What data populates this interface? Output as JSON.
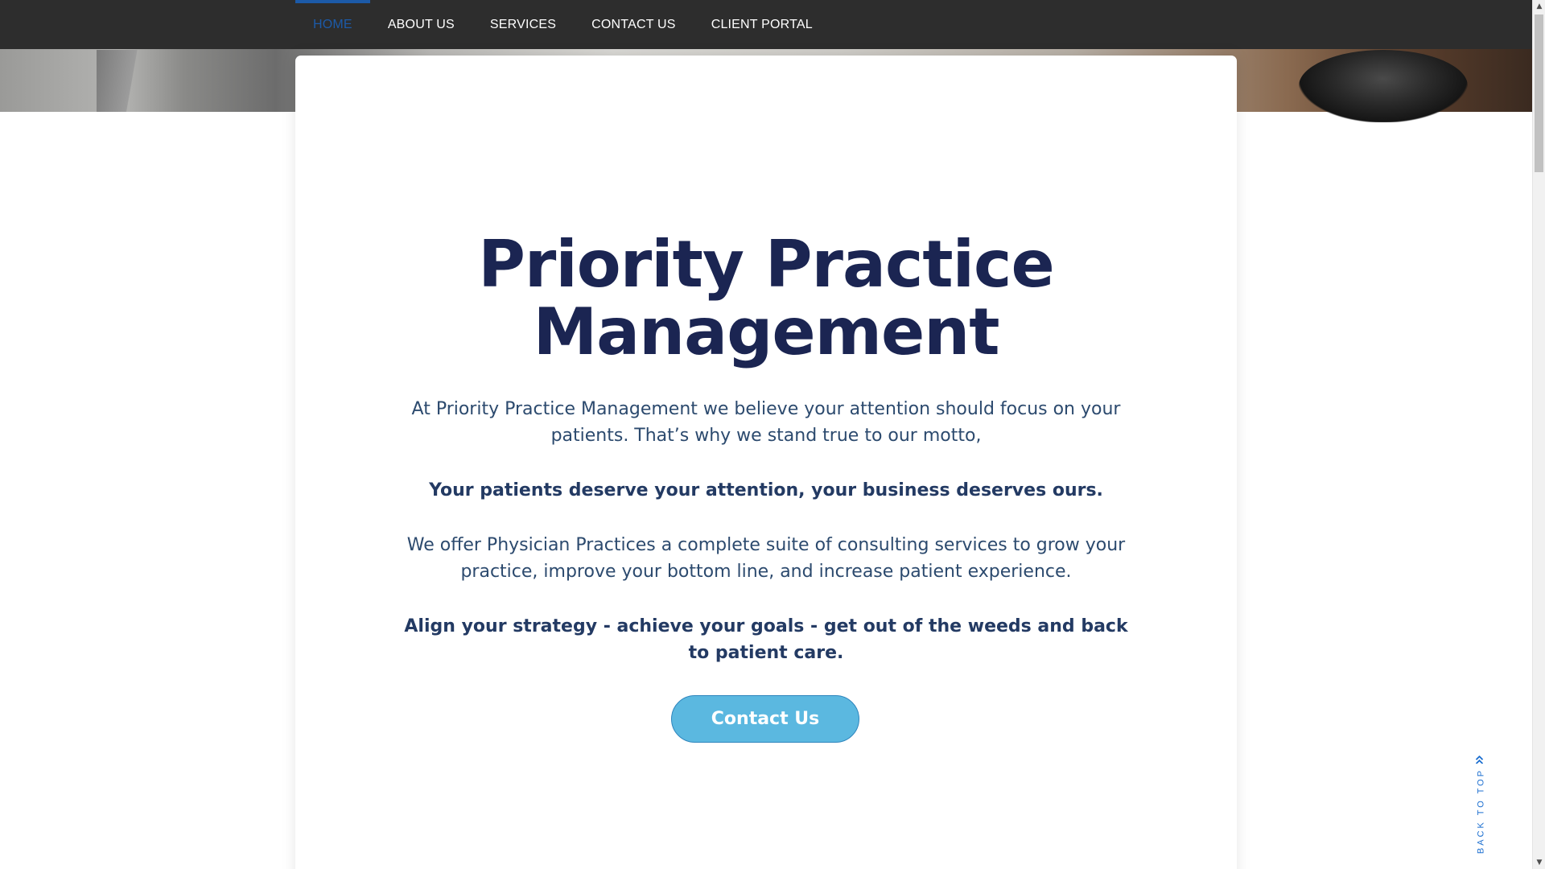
{
  "nav": {
    "items": [
      {
        "label": "HOME",
        "active": true
      },
      {
        "label": "ABOUT US",
        "active": false
      },
      {
        "label": "SERVICES",
        "active": false
      },
      {
        "label": "CONTACT US",
        "active": false
      },
      {
        "label": "CLIENT PORTAL",
        "active": false
      }
    ]
  },
  "hero": {
    "title_line1": "Priority Practice",
    "title_line2": "Management",
    "intro": "At Priority Practice Management we believe your attention should focus on your patients. That’s why we stand true to our motto,",
    "motto": "Your patients deserve your attention, your business deserves ours.",
    "offer": "We offer Physician Practices a complete suite of consulting services to grow your practice, improve your bottom line, and increase patient experience.",
    "tagline": "Align your strategy - achieve your goals - get out of the weeds and back to patient care.",
    "cta_label": "Contact Us"
  },
  "back_to_top": {
    "label": "BACK TO TOP",
    "icon": "double-chevron-up-icon"
  },
  "colors": {
    "nav_bg": "#2d2d2d",
    "nav_active": "#1c5aa8",
    "title": "#1b2552",
    "body_text": "#2c4a6e",
    "cta_bg": "#5bb8e0",
    "back_to_top": "#1c6fd0"
  }
}
